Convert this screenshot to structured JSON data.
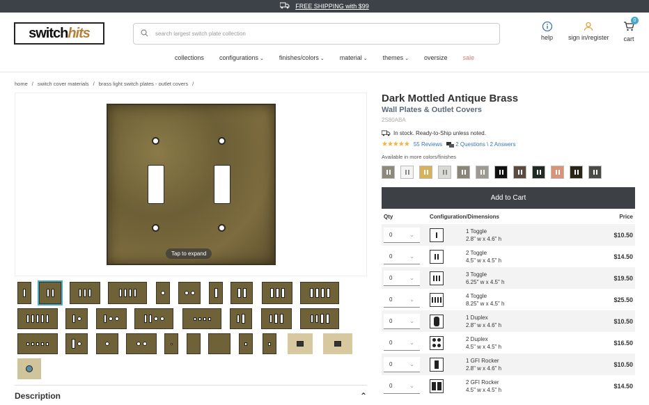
{
  "topbar": {
    "shipping": "FREE SHIPPING with $99"
  },
  "header": {
    "logo_left": "switch",
    "logo_right": "hits",
    "search_placeholder": "search largest switch plate collection",
    "help": "help",
    "signin": "sign in/register",
    "cart": "cart",
    "cart_count": "0"
  },
  "nav": [
    {
      "label": "collections",
      "caret": false
    },
    {
      "label": "configurations",
      "caret": true
    },
    {
      "label": "finishes/colors",
      "caret": true
    },
    {
      "label": "material",
      "caret": true
    },
    {
      "label": "themes",
      "caret": true
    },
    {
      "label": "oversize",
      "caret": false
    },
    {
      "label": "sale",
      "caret": false
    }
  ],
  "breadcrumb": [
    "home",
    "/",
    "switch cover materials",
    "/",
    "brass light switch plates - outlet covers",
    "/"
  ],
  "gallery": {
    "expand": "Tap to expand"
  },
  "product": {
    "title": "Dark Mottled Antique Brass",
    "subtitle": "Wall Plates & Outlet Covers",
    "sku": "2S80ABA",
    "stock": "In stock. Ready-to-Ship unless noted.",
    "stars": "★★★★★",
    "reviews": "55 Reviews",
    "qa": "2 Questions \\ 2 Answers",
    "avail": "Available in more colors/finishes",
    "add_to_cart": "Add to Cart"
  },
  "swatch_colors": [
    "#8d8a7c",
    "#f4f4f4",
    "#d8b25a",
    "#d9d9d6",
    "#8a8577",
    "#9e9a92",
    "#111111",
    "#5b4a3f",
    "#1f2a22",
    "#d99477",
    "#2a2417",
    "#4b4b45"
  ],
  "table": {
    "headers": {
      "qty": "Qty",
      "config": "Configuration/Dimensions",
      "price": "Price"
    },
    "rows": [
      {
        "qty": "0",
        "name": "1 Toggle",
        "dims": "2.8\" w x 4.6\" h",
        "price": "$10.50"
      },
      {
        "qty": "0",
        "name": "2 Toggle",
        "dims": "4.5\" w x 4.5\" h",
        "price": "$14.50"
      },
      {
        "qty": "0",
        "name": "3 Toggle",
        "dims": "6.25\" w x 4.5\" h",
        "price": "$19.50"
      },
      {
        "qty": "0",
        "name": "4 Toggle",
        "dims": "8.25\" w x 4.5\" h",
        "price": "$25.50"
      },
      {
        "qty": "0",
        "name": "1 Duplex",
        "dims": "2.8\" w x 4.6\" h",
        "price": "$10.50"
      },
      {
        "qty": "0",
        "name": "2 Duplex",
        "dims": "4.5\" w x 4.5\" h",
        "price": "$16.50"
      },
      {
        "qty": "0",
        "name": "1 GFI Rocker",
        "dims": "2.8\" w x 4.6\" h",
        "price": "$10.50"
      },
      {
        "qty": "0",
        "name": "2 GFI Rocker",
        "dims": "4.5\" w x 4.5\" h",
        "price": "$14.50"
      }
    ]
  },
  "description": {
    "label": "Description",
    "chevron": "⌃"
  }
}
